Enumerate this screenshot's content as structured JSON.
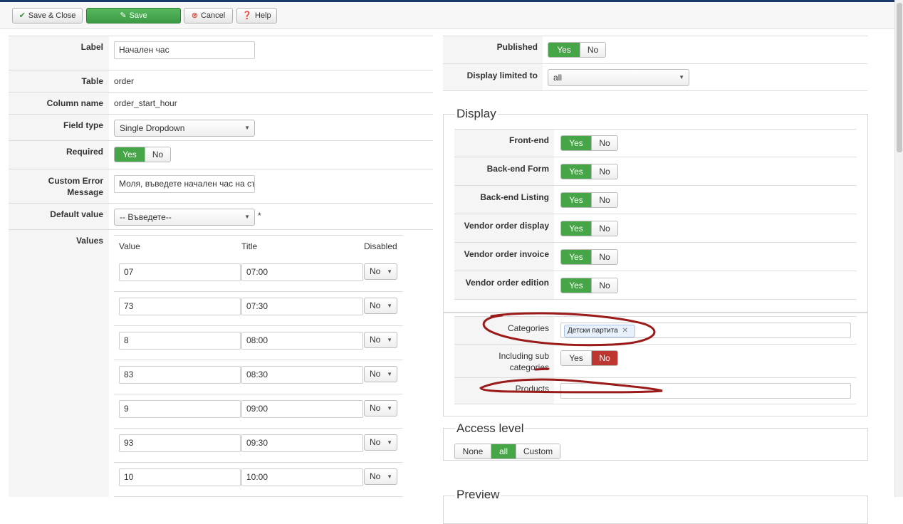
{
  "toolbar": {
    "save_close": "Save & Close",
    "save": "Save",
    "cancel": "Cancel",
    "help": "Help"
  },
  "form": {
    "label": {
      "label": "Label",
      "value": "Начален час"
    },
    "table": {
      "label": "Table",
      "value": "order"
    },
    "column": {
      "label": "Column name",
      "value": "order_start_hour"
    },
    "field_type": {
      "label": "Field type",
      "value": "Single Dropdown"
    },
    "required": {
      "label": "Required",
      "yes": "Yes",
      "no": "No"
    },
    "custom_error": {
      "label_1": "Custom Error",
      "label_2": "Message",
      "value": "Моля, въведете начален час на съ"
    },
    "default_value": {
      "label": "Default value",
      "value": "-- Въведете--",
      "asterisk": "*"
    },
    "values": {
      "label": "Values",
      "col_value": "Value",
      "col_title": "Title",
      "col_disabled": "Disabled",
      "rows": [
        {
          "value": "07",
          "title": "07:00",
          "disabled": "No"
        },
        {
          "value": "73",
          "title": "07:30",
          "disabled": "No"
        },
        {
          "value": "8",
          "title": "08:00",
          "disabled": "No"
        },
        {
          "value": "83",
          "title": "08:30",
          "disabled": "No"
        },
        {
          "value": "9",
          "title": "09:00",
          "disabled": "No"
        },
        {
          "value": "93",
          "title": "09:30",
          "disabled": "No"
        },
        {
          "value": "10",
          "title": "10:00",
          "disabled": "No"
        }
      ]
    }
  },
  "right": {
    "published": {
      "label": "Published",
      "yes": "Yes",
      "no": "No"
    },
    "display_limited": {
      "label": "Display limited to",
      "value": "all"
    },
    "display": {
      "legend": "Display",
      "rows": [
        {
          "label": "Front-end",
          "yes": "Yes",
          "no": "No"
        },
        {
          "label": "Back-end Form",
          "yes": "Yes",
          "no": "No"
        },
        {
          "label": "Back-end Listing",
          "yes": "Yes",
          "no": "No"
        },
        {
          "label": "Vendor order display",
          "yes": "Yes",
          "no": "No"
        },
        {
          "label": "Vendor order invoice",
          "yes": "Yes",
          "no": "No"
        },
        {
          "label": "Vendor order edition",
          "yes": "Yes",
          "no": "No"
        }
      ]
    },
    "categories": {
      "label": "Categories",
      "tag": "Детски партита",
      "remove": "✕"
    },
    "including_sub": {
      "label_1": "Including sub",
      "label_2": "categories",
      "yes": "Yes",
      "no": "No"
    },
    "products": {
      "label": "Products",
      "value": ""
    },
    "access_level": {
      "legend": "Access level",
      "none": "None",
      "all": "all",
      "custom": "Custom"
    },
    "preview": {
      "legend": "Preview"
    }
  },
  "colors": {
    "green": "#46a546",
    "red": "#bd362f",
    "annotation": "#9b1b1b"
  }
}
